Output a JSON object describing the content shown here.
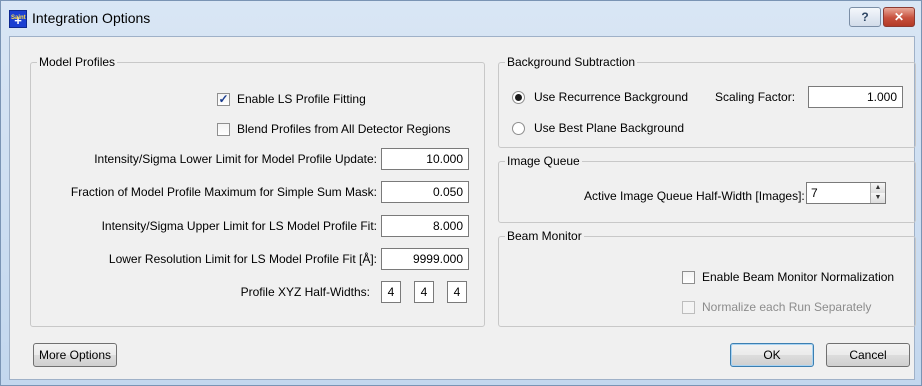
{
  "window": {
    "title": "Integration Options",
    "app_icon": {
      "text": "+",
      "caption": "Saint"
    },
    "help_label": "?",
    "close_label": "✕"
  },
  "model_profiles": {
    "title": "Model Profiles",
    "enable_ls": {
      "label": "Enable LS Profile Fitting",
      "checked": true
    },
    "blend": {
      "label": "Blend Profiles from All Detector Regions",
      "checked": false
    },
    "fields": [
      {
        "label": "Intensity/Sigma Lower Limit for Model Profile Update:",
        "value": "10.000"
      },
      {
        "label": "Fraction of Model Profile Maximum for Simple Sum Mask:",
        "value": "0.050"
      },
      {
        "label": "Intensity/Sigma Upper Limit for LS Model Profile Fit:",
        "value": "8.000"
      },
      {
        "label": "Lower Resolution Limit for LS Model Profile Fit [Å]:",
        "value": "9999.000"
      }
    ],
    "xyz": {
      "label": "Profile XYZ Half-Widths:",
      "x": "4",
      "y": "4",
      "z": "4"
    }
  },
  "background": {
    "title": "Background Subtraction",
    "recurrence": {
      "label": "Use Recurrence Background",
      "selected": true
    },
    "scaling_label": "Scaling Factor:",
    "scaling_value": "1.000",
    "best_plane": {
      "label": "Use Best Plane Background",
      "selected": false
    }
  },
  "image_queue": {
    "title": "Image Queue",
    "label": "Active Image Queue Half-Width [Images]:",
    "value": "7"
  },
  "beam_monitor": {
    "title": "Beam Monitor",
    "enable": {
      "label": "Enable Beam Monitor Normalization",
      "checked": false
    },
    "per_run": {
      "label": "Normalize each Run Separately",
      "checked": false,
      "enabled": false
    }
  },
  "buttons": {
    "more": "More Options",
    "ok": "OK",
    "cancel": "Cancel"
  }
}
